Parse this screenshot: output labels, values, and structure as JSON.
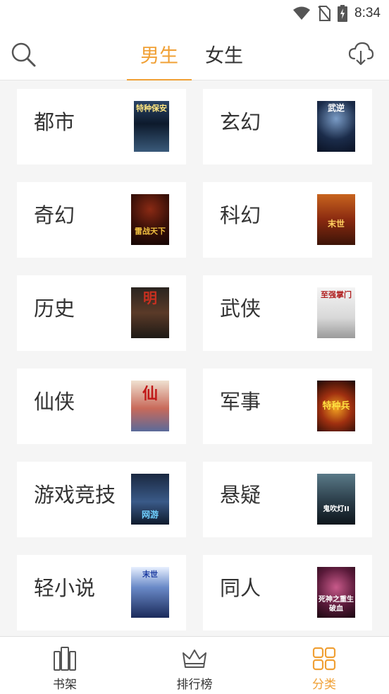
{
  "status_bar": {
    "time": "8:34",
    "icons": [
      "wifi-icon",
      "no-sim-icon",
      "battery-charging-icon"
    ]
  },
  "header": {
    "tabs": [
      {
        "label": "男生",
        "active": true
      },
      {
        "label": "女生",
        "active": false
      }
    ],
    "search_icon": "search-icon",
    "download_icon": "cloud-download-icon"
  },
  "categories": [
    {
      "label": "都市",
      "cover_text": "特种保安"
    },
    {
      "label": "玄幻",
      "cover_text": "武逆"
    },
    {
      "label": "奇幻",
      "cover_text": "雷战天下"
    },
    {
      "label": "科幻",
      "cover_text": "末世"
    },
    {
      "label": "历史",
      "cover_text": "明"
    },
    {
      "label": "武侠",
      "cover_text": "至强掌门"
    },
    {
      "label": "仙侠",
      "cover_text": "仙"
    },
    {
      "label": "军事",
      "cover_text": "特种兵"
    },
    {
      "label": "游戏竞技",
      "cover_text": "网游"
    },
    {
      "label": "悬疑",
      "cover_text": "鬼吹灯II"
    },
    {
      "label": "轻小说",
      "cover_text": "末世"
    },
    {
      "label": "同人",
      "cover_text": "死神之重生破血"
    }
  ],
  "bottom_nav": [
    {
      "label": "书架",
      "icon": "bookshelf-icon",
      "active": false
    },
    {
      "label": "排行榜",
      "icon": "crown-icon",
      "active": false
    },
    {
      "label": "分类",
      "icon": "grid-icon",
      "active": true
    }
  ],
  "colors": {
    "accent": "#f0a035",
    "text": "#333333",
    "background": "#f5f5f5"
  }
}
